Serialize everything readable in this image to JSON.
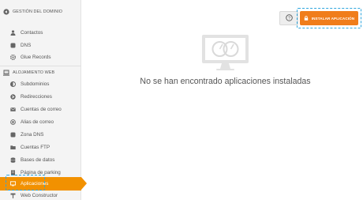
{
  "sidebar": {
    "sections": [
      {
        "title": "GESTIÓN DEL DOMINIO",
        "icon": "globe-icon",
        "items": [
          {
            "label": "Contactos",
            "icon": "user-icon"
          },
          {
            "label": "DNS",
            "icon": "database-icon"
          },
          {
            "label": "Glue Records",
            "icon": "gear-icon"
          }
        ]
      },
      {
        "title": "ALOJAMIENTO WEB",
        "icon": "server-icon",
        "items": [
          {
            "label": "Subdominios",
            "icon": "half-circle-icon"
          },
          {
            "label": "Redirecciones",
            "icon": "redirect-icon"
          },
          {
            "label": "Cuentas de correo",
            "icon": "envelope-icon"
          },
          {
            "label": "Alias de correo",
            "icon": "at-icon"
          },
          {
            "label": "Zona DNS",
            "icon": "database-icon"
          },
          {
            "label": "Cuentas FTP",
            "icon": "folder-icon"
          },
          {
            "label": "Bases de datos",
            "icon": "database-icon"
          },
          {
            "label": "Página de parking",
            "icon": "document-icon"
          },
          {
            "label": "Aplicaciones",
            "icon": "monitor-icon",
            "active": true
          },
          {
            "label": "Web Constructor",
            "icon": "hammer-icon"
          }
        ]
      }
    ]
  },
  "toolbar": {
    "help_icon": "question-circle-icon",
    "install_label": "INSTALAR APLICACIÓN",
    "install_icon": "lock-icon"
  },
  "main": {
    "empty_icon": "monitor-gauge-icon",
    "empty_message": "No se han encontrado aplicaciones instaladas"
  },
  "colors": {
    "accent": "#f29100",
    "install_button": "#f07d1b",
    "highlight": "#2fa6de",
    "sidebar_bg": "#f4f4f4"
  }
}
